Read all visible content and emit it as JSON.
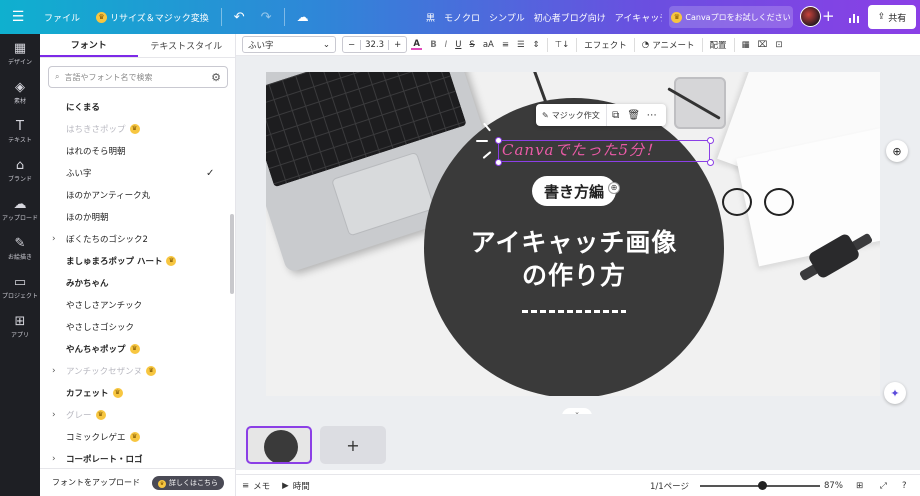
{
  "topbar": {
    "menu_icon": "hamburger-icon",
    "file_label": "ファイル",
    "resize_label": "リサイズ＆マジック変換",
    "doc_title": "黒　モノクロ　シンプル　初心者ブログ向け　アイキャッチ画...",
    "pro_label": "Canvaプロをお試しください",
    "share_label": "共有"
  },
  "rail": {
    "items": [
      {
        "icon": "design-icon",
        "glyph": "▦",
        "label": "デザイン"
      },
      {
        "icon": "elements-icon",
        "glyph": "◈",
        "label": "素材"
      },
      {
        "icon": "text-icon",
        "glyph": "T",
        "label": "テキスト"
      },
      {
        "icon": "brand-icon",
        "glyph": "⌂",
        "label": "ブランド"
      },
      {
        "icon": "upload-icon",
        "glyph": "☁",
        "label": "アップロード"
      },
      {
        "icon": "draw-icon",
        "glyph": "✎",
        "label": "お絵描き"
      },
      {
        "icon": "projects-icon",
        "glyph": "▭",
        "label": "プロジェクト"
      },
      {
        "icon": "apps-icon",
        "glyph": "⊞",
        "label": "アプリ"
      }
    ]
  },
  "panel": {
    "tabs": [
      "フォント",
      "テキストスタイル"
    ],
    "search_placeholder": "言語やフォント名で検索",
    "fonts": [
      {
        "name": "にくまる",
        "expandable": false,
        "pro": false,
        "faded": false,
        "checked": false,
        "bold": true
      },
      {
        "name": "はちきさポップ",
        "expandable": false,
        "pro": true,
        "faded": true,
        "checked": false,
        "bold": false
      },
      {
        "name": "はれのそら明朝",
        "expandable": false,
        "pro": false,
        "faded": false,
        "checked": false,
        "bold": false
      },
      {
        "name": "ふい字",
        "expandable": false,
        "pro": false,
        "faded": false,
        "checked": true,
        "bold": false
      },
      {
        "name": "ほのかアンティーク丸",
        "expandable": false,
        "pro": false,
        "faded": false,
        "checked": false,
        "bold": false
      },
      {
        "name": "ほのか明朝",
        "expandable": false,
        "pro": false,
        "faded": false,
        "checked": false,
        "bold": false
      },
      {
        "name": "ぼくたちのゴシック2",
        "expandable": true,
        "pro": false,
        "faded": false,
        "checked": false,
        "bold": false
      },
      {
        "name": "ましゅまろポップ ハート",
        "expandable": false,
        "pro": true,
        "faded": false,
        "checked": false,
        "bold": true
      },
      {
        "name": "みかちゃん",
        "expandable": false,
        "pro": false,
        "faded": false,
        "checked": false,
        "bold": true
      },
      {
        "name": "やさしさアンチック",
        "expandable": false,
        "pro": false,
        "faded": false,
        "checked": false,
        "bold": false
      },
      {
        "name": "やさしさゴシック",
        "expandable": false,
        "pro": false,
        "faded": false,
        "checked": false,
        "bold": false
      },
      {
        "name": "やんちゃポップ",
        "expandable": false,
        "pro": true,
        "faded": false,
        "checked": false,
        "bold": true
      },
      {
        "name": "アンチックセザンヌ",
        "expandable": true,
        "pro": true,
        "faded": true,
        "checked": false,
        "bold": false
      },
      {
        "name": "カフェット",
        "expandable": false,
        "pro": true,
        "faded": false,
        "checked": false,
        "bold": true
      },
      {
        "name": "グレー",
        "expandable": true,
        "pro": true,
        "faded": true,
        "checked": false,
        "bold": false
      },
      {
        "name": "コミックレゲエ",
        "expandable": false,
        "pro": true,
        "faded": false,
        "checked": false,
        "bold": false
      },
      {
        "name": "コーポレート・ロゴ",
        "expandable": true,
        "pro": false,
        "faded": false,
        "checked": false,
        "bold": true
      }
    ],
    "upgrade_label": "フォントをアップロード",
    "upgrade_badge": "詳しくはこちら"
  },
  "toolbar": {
    "font_name": "ふい字",
    "minus": "−",
    "font_size": "32.3",
    "plus": "+",
    "color_letter": "A",
    "bold": "B",
    "italic": "I",
    "underline": "U",
    "strike": "S",
    "case": "aA",
    "effects_label": "エフェクト",
    "animate_label": "アニメート",
    "position_label": "配置"
  },
  "canvas": {
    "subtitle": "Canvaでたった5分！",
    "pill_text": "書き方編",
    "headline_line1": "アイキャッチ画像",
    "headline_line2": "の作り方",
    "magic_write_label": "マジック作文"
  },
  "footer": {
    "notes_label": "メモ",
    "timer_label": "時間",
    "page_label": "1/1ページ",
    "zoom": "87%",
    "zoom_fraction": 0.52
  },
  "colors": {
    "accent": "#8b3fe6",
    "pink_text": "#e95aa6",
    "circle": "#3a3a3a"
  }
}
